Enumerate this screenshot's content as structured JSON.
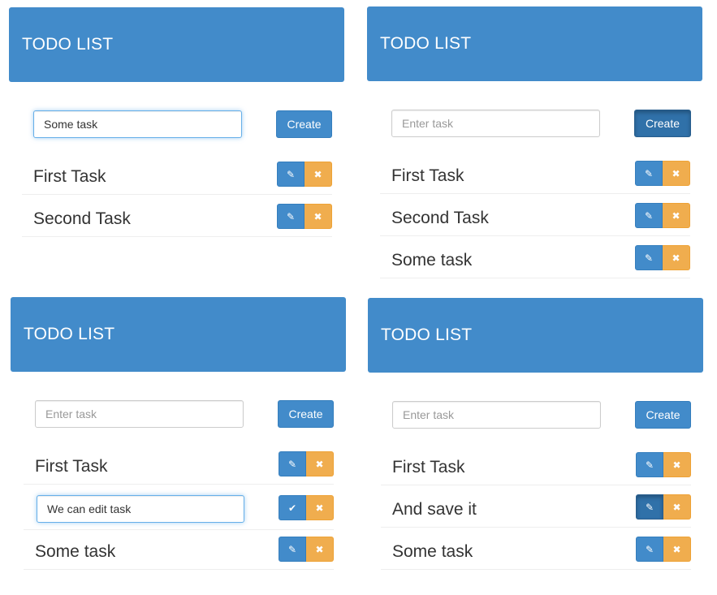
{
  "panels": [
    {
      "title": "TODO LIST",
      "input": {
        "value": "Some task",
        "placeholder": "Enter task",
        "focused": true
      },
      "create_label": "Create",
      "tasks": [
        "First Task",
        "Second Task"
      ]
    },
    {
      "title": "TODO LIST",
      "input": {
        "value": "",
        "placeholder": "Enter task",
        "focused": false
      },
      "create_label": "Create",
      "tasks": [
        "First Task",
        "Second Task",
        "Some task"
      ]
    },
    {
      "title": "TODO LIST",
      "input": {
        "value": "",
        "placeholder": "Enter task",
        "focused": false
      },
      "create_label": "Create",
      "tasks": [
        "First Task",
        "",
        "Some task"
      ],
      "editing": {
        "index": 1,
        "value": "We can edit task"
      }
    },
    {
      "title": "TODO LIST",
      "input": {
        "value": "",
        "placeholder": "Enter task",
        "focused": false
      },
      "create_label": "Create",
      "tasks": [
        "First Task",
        "And save it",
        "Some task"
      ]
    }
  ],
  "icons": {
    "edit": "pencil-icon",
    "delete": "times-icon",
    "save": "check-icon"
  },
  "colors": {
    "primary": "#428bca",
    "warning": "#f0ad4e",
    "focus_border": "#66afe9"
  }
}
